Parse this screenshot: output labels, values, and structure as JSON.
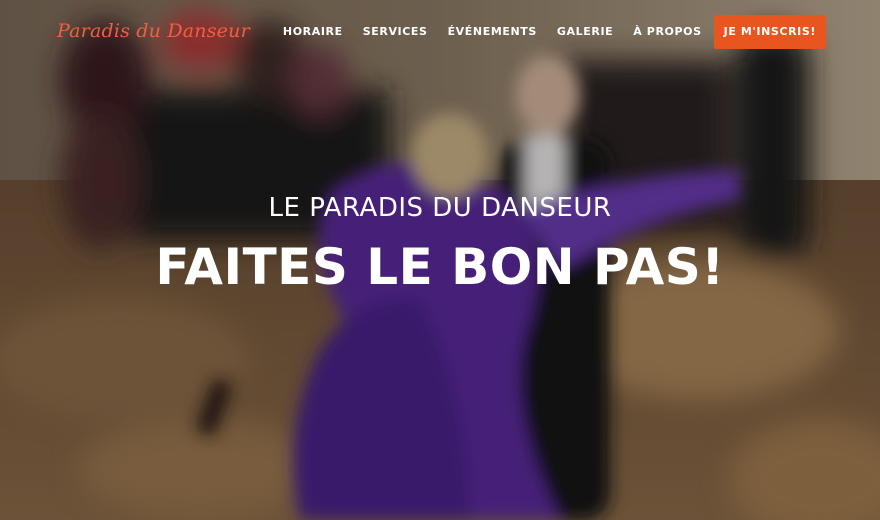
{
  "brand": {
    "name": "Paradis du Danseur",
    "color": "#f05f40"
  },
  "nav": {
    "items": [
      {
        "label": "HORAIRE"
      },
      {
        "label": "SERVICES"
      },
      {
        "label": "ÉVÉNEMENTS"
      },
      {
        "label": "GALERIE"
      },
      {
        "label": "À PROPOS"
      }
    ],
    "cta": {
      "label": "JE M'INSCRIS!",
      "color": "#e8551e"
    }
  },
  "hero": {
    "subtitle": "LE PARADIS DU DANSEUR",
    "title": "FAITES LE BON PAS!",
    "background_image": "blurred-ballroom-dancers-photo"
  }
}
